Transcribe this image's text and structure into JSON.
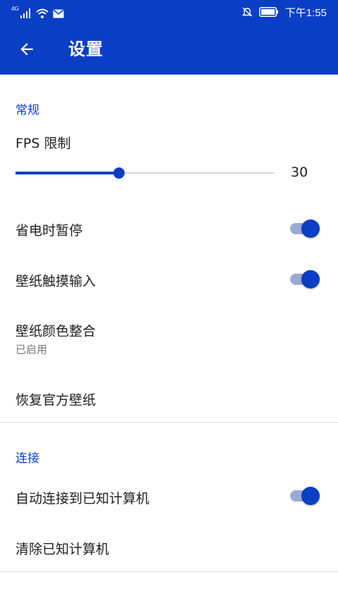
{
  "status_bar": {
    "network_label": "4G",
    "time": "下午1:55",
    "icons": [
      "signal-icon",
      "wifi-icon",
      "mail-icon",
      "bell-off-icon",
      "battery-icon"
    ]
  },
  "app_bar": {
    "back_icon": "arrow-left-icon",
    "title": "设置"
  },
  "colors": {
    "primary": "#0a3ec4",
    "section_header": "#0a3ec4",
    "toggle_track_on": "#9aaad6",
    "summary_text": "#757575"
  },
  "sections": {
    "general": {
      "header": "常规",
      "fps_limit": {
        "title": "FPS 限制",
        "value": "30",
        "slider_fraction": 0.4
      },
      "pause_on_battery_saver": {
        "title": "省电时暂停",
        "enabled": true
      },
      "wallpaper_touch_input": {
        "title": "壁纸触摸输入",
        "enabled": true
      },
      "wallpaper_color_integration": {
        "title": "壁纸颜色整合",
        "summary": "已启用"
      },
      "restore_official_wallpaper": {
        "title": "恢复官方壁纸"
      }
    },
    "connection": {
      "header": "连接",
      "auto_connect_known_computers": {
        "title": "自动连接到已知计算机",
        "enabled": true
      },
      "clear_known_computers": {
        "title": "清除已知计算机"
      }
    }
  }
}
